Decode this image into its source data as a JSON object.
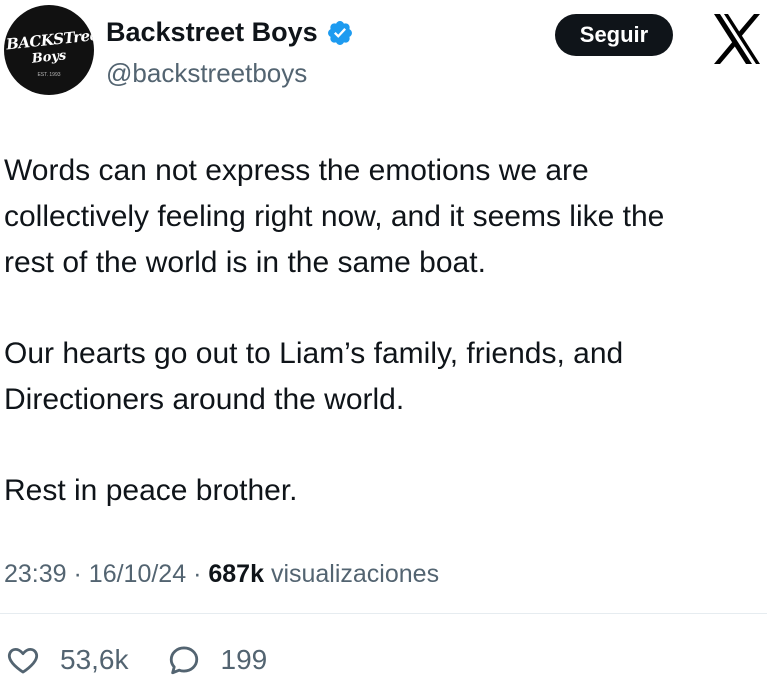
{
  "profile": {
    "avatar_line1": "BACKSTreet",
    "avatar_line2": "Boys",
    "avatar_line3": "EST. 1993",
    "name": "Backstreet Boys",
    "handle": "@backstreetboys",
    "verified_icon": "verified-badge-icon",
    "verified_color": "#1d9bf0"
  },
  "header": {
    "follow_label": "Seguir",
    "logo_icon": "x-logo-icon"
  },
  "tweet": {
    "paragraphs": [
      "Words can not express the emotions we are\ncollectively feeling right now, and it seems like the\nrest of the world is in the same boat.",
      "Our hearts go out to Liam’s family, friends, and\nDirectioners around the world.",
      "Rest in peace brother."
    ]
  },
  "meta": {
    "time": "23:39",
    "date": "16/10/24",
    "views_count": "687k",
    "views_label": "visualizaciones",
    "separator": "·"
  },
  "actions": {
    "likes": "53,6k",
    "replies": "199",
    "like_icon": "heart-icon",
    "reply_icon": "reply-icon"
  }
}
